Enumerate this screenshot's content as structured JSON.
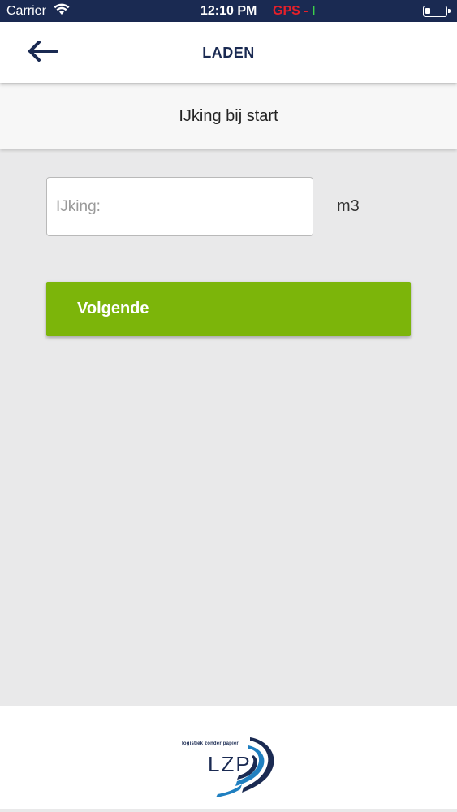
{
  "status_bar": {
    "carrier": "Carrier",
    "time": "12:10 PM",
    "gps_label": "GPS",
    "gps_separator": " - ",
    "gps_indicator": "I",
    "icons": {
      "wifi": "wifi-icon",
      "battery": "battery-icon"
    }
  },
  "header": {
    "title": "LADEN",
    "back_icon": "arrow-left-icon"
  },
  "subheader": {
    "title": "IJking bij start"
  },
  "form": {
    "ijking_placeholder": "IJking:",
    "ijking_value": "",
    "unit": "m3",
    "next_label": "Volgende"
  },
  "footer": {
    "logo_tagline": "logistiek zonder papier",
    "logo_brand": "LZP"
  },
  "colors": {
    "primary_navy": "#1a2a52",
    "accent_green": "#7cb50a",
    "gps_red": "#e5202a",
    "gps_green": "#3cd14a",
    "background": "#e9e9ea"
  }
}
